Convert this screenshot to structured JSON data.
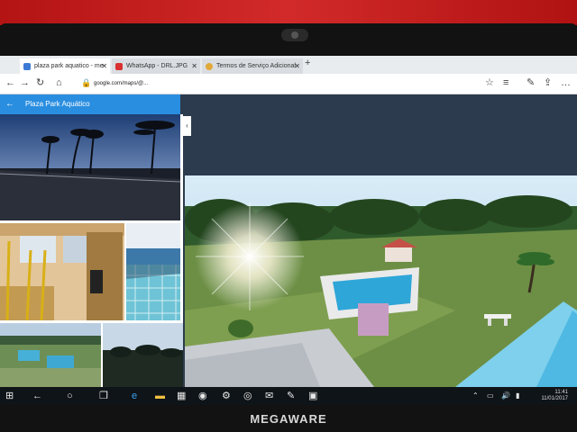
{
  "browser": {
    "tabs": [
      {
        "label": "plaza park aquatico - me",
        "active": true
      },
      {
        "label": "WhatsApp - DRL.JPG",
        "active": false
      },
      {
        "label": "Termos de Serviço Adicional",
        "active": false
      }
    ],
    "url_visible": "google.com/maps/@...",
    "new_tab_icon": "plus-icon"
  },
  "maps_panel": {
    "title": "Plaza Park Aquático",
    "back_icon": "back-arrow-icon",
    "collapse_icon": "chevron-left-icon"
  },
  "taskbar": {
    "time": "11:41",
    "date": "11/01/2017"
  },
  "laptop": {
    "brand": "MEGAWARE"
  },
  "colors": {
    "accent": "#2a8ee0",
    "wall": "#c41e1e",
    "water": "#4fb9e3"
  }
}
